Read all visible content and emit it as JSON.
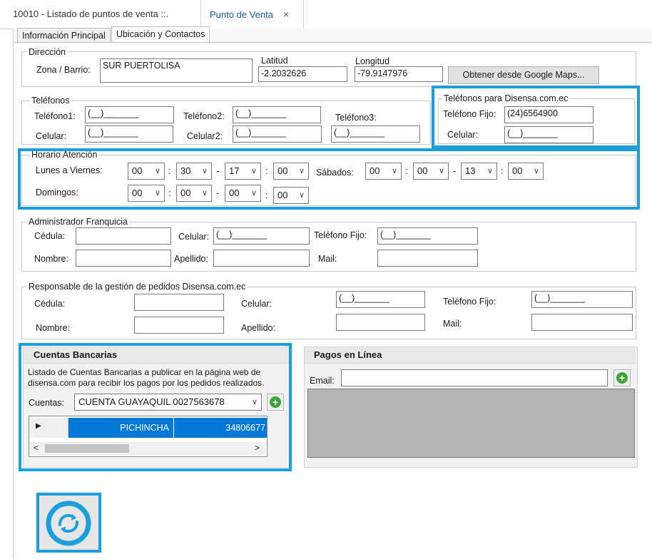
{
  "doc_tabs": {
    "inactive": "10010 - Listado de puntos de venta ::.",
    "active": "Punto de Venta",
    "close": "×"
  },
  "inner_tabs": {
    "principal": "Información Principal",
    "ubicacion": "Ubicación y Contactos"
  },
  "direccion": {
    "legend": "Dirección",
    "zona_label": "Zona / Barrio:",
    "zona_value": "SUR PUERTOLISA",
    "latitud_label": "Latitud",
    "latitud_value": "-2.2032626",
    "longitud_label": "Longitud",
    "longitud_value": "-79.9147976",
    "maps_button": "Obtener desde Google Maps..."
  },
  "telefonos": {
    "legend": "Teléfonos",
    "tel1_label": "Teléfono1:",
    "tel1_value": "(__)_______",
    "tel2_label": "Teléfono2:",
    "tel2_value": "(__)_______",
    "tel3_label": "Teléfono3:",
    "tel3_value": "(__)_______",
    "cel_label": "Celular:",
    "cel_value": "(__)_______",
    "cel2_label": "Celular2:",
    "cel2_value": "(__)_______"
  },
  "disensa_tel": {
    "legend": "Teléfonos para Disensa.com.ec",
    "fijo_label": "Teléfono Fijo:",
    "fijo_value": "(24)6564900",
    "cel_label": "Celular:",
    "cel_value": "(__)_______"
  },
  "horario": {
    "legend": "Horario Atención",
    "lv_label": "Lunes a Viernes:",
    "sab_label": "Sábados:",
    "dom_label": "Domingos:",
    "colon": ":",
    "dash": "-",
    "lv": [
      "00",
      "30",
      "17",
      "00"
    ],
    "sab": [
      "00",
      "00",
      "13",
      "00"
    ],
    "dom": [
      "00",
      "00",
      "00",
      "00"
    ]
  },
  "admin": {
    "legend": "Administrador Franquicia",
    "cedula_label": "Cédula:",
    "celular_label": "Celular:",
    "celular_value": "(__)_______",
    "fijo_label": "Teléfono Fijo:",
    "fijo_value": "(__)_______",
    "nombre_label": "Nombre:",
    "apellido_label": "Apellido:",
    "mail_label": "Mail:"
  },
  "resp": {
    "legend": "Responsable de la gestión de pedidos Disensa.com.ec",
    "cedula_label": "Cédula:",
    "celular_label": "Celular:",
    "celular_value": "(__)_______",
    "fijo_label": "Teléfono Fijo:",
    "fijo_value": "(__)_______",
    "nombre_label": "Nombre:",
    "apellido_label": "Apellido:",
    "mail_label": "Mail:"
  },
  "cuentas": {
    "title": "Cuentas Bancarias",
    "desc1": "Listado de Cuentas Bancarias a publicar en la página web de",
    "desc2": "disensa.com para recibir los pagos por los pedidos realizados.",
    "label": "Cuentas:",
    "selected": "CUENTA GUAYAQUIL 0027563678",
    "row_bank": "PICHINCHA",
    "row_number": "34806677"
  },
  "pagos": {
    "title": "Pagos en Línea",
    "email_label": "Email:"
  },
  "colors": {
    "highlight": "#1a9fdc",
    "selection": "#0078d7",
    "add_green": "#3aa43a"
  }
}
